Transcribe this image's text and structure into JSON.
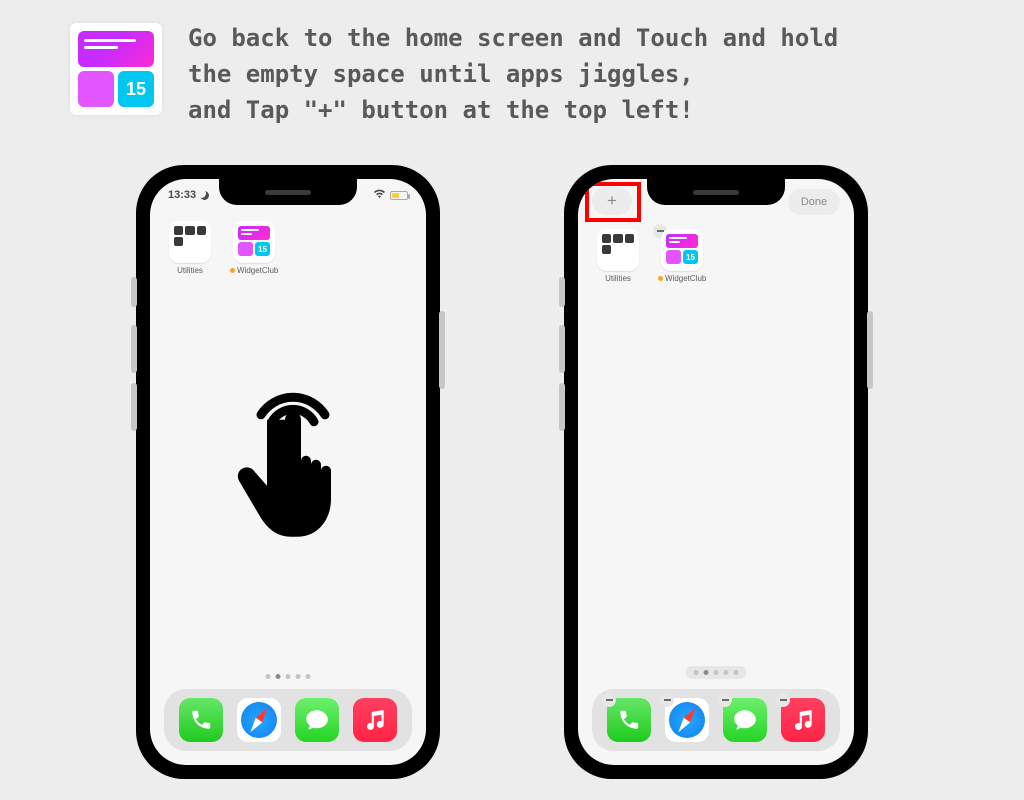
{
  "header": {
    "widget_number": "15",
    "instructions": "Go back to the home screen and Touch and hold\nthe empty space until apps jiggles,\nand Tap \"+\" button at the top left!"
  },
  "phone_left": {
    "time": "13:33",
    "apps": {
      "utilities_label": "Utilities",
      "widgetclub_label": "WidgetClub",
      "widgetclub_number": "15"
    },
    "page_count": 5,
    "active_page": 1
  },
  "phone_right": {
    "plus_label": "+",
    "done_label": "Done",
    "apps": {
      "utilities_label": "Utilities",
      "widgetclub_label": "WidgetClub",
      "widgetclub_number": "15"
    },
    "page_count": 5,
    "active_page": 1
  },
  "dock": {
    "items": [
      "Phone",
      "Safari",
      "Messages",
      "Music"
    ]
  },
  "highlight": {
    "plus_button": true
  }
}
